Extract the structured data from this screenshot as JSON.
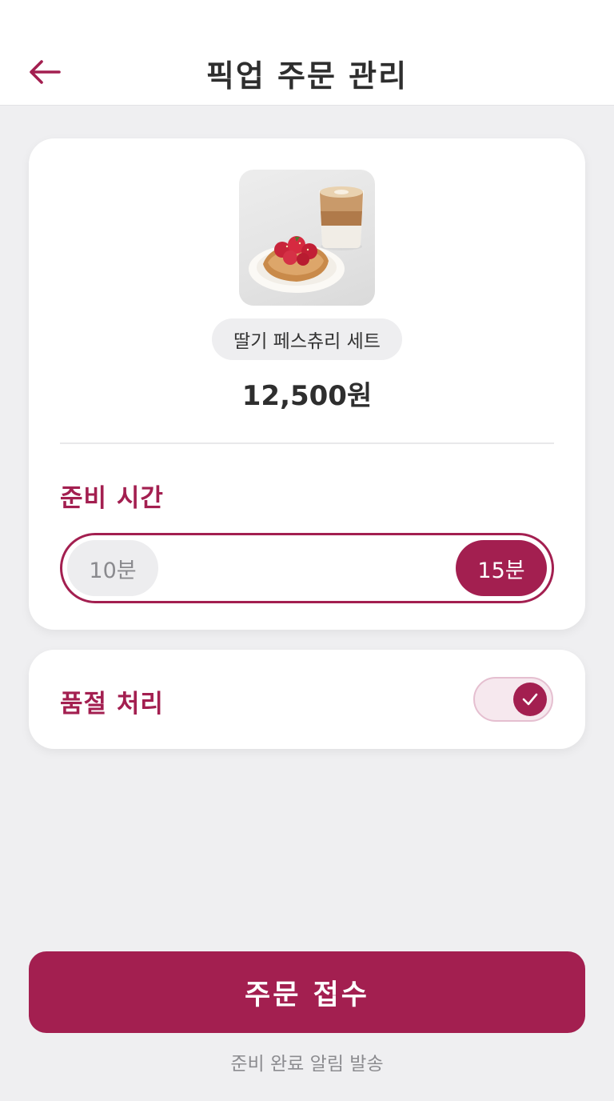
{
  "header": {
    "title": "픽업 주문 관리",
    "back_icon": "arrow-left-icon"
  },
  "product": {
    "image_icon": "pastry-coffee-photo",
    "name": "딸기 페스츄리 세트",
    "price": "12,500원"
  },
  "prep_time": {
    "label": "준비 시간",
    "options": [
      "10분",
      "15분"
    ],
    "selected": "15분"
  },
  "sold_out": {
    "label": "품절 처리",
    "toggle_on": true,
    "toggle_icon": "checkmark-icon"
  },
  "actions": {
    "accept_label": "주문 접수",
    "caption": "준비 완료 알림 발송"
  },
  "colors": {
    "accent": "#A31F50",
    "background": "#EFEFF1",
    "card": "#FFFFFF"
  }
}
